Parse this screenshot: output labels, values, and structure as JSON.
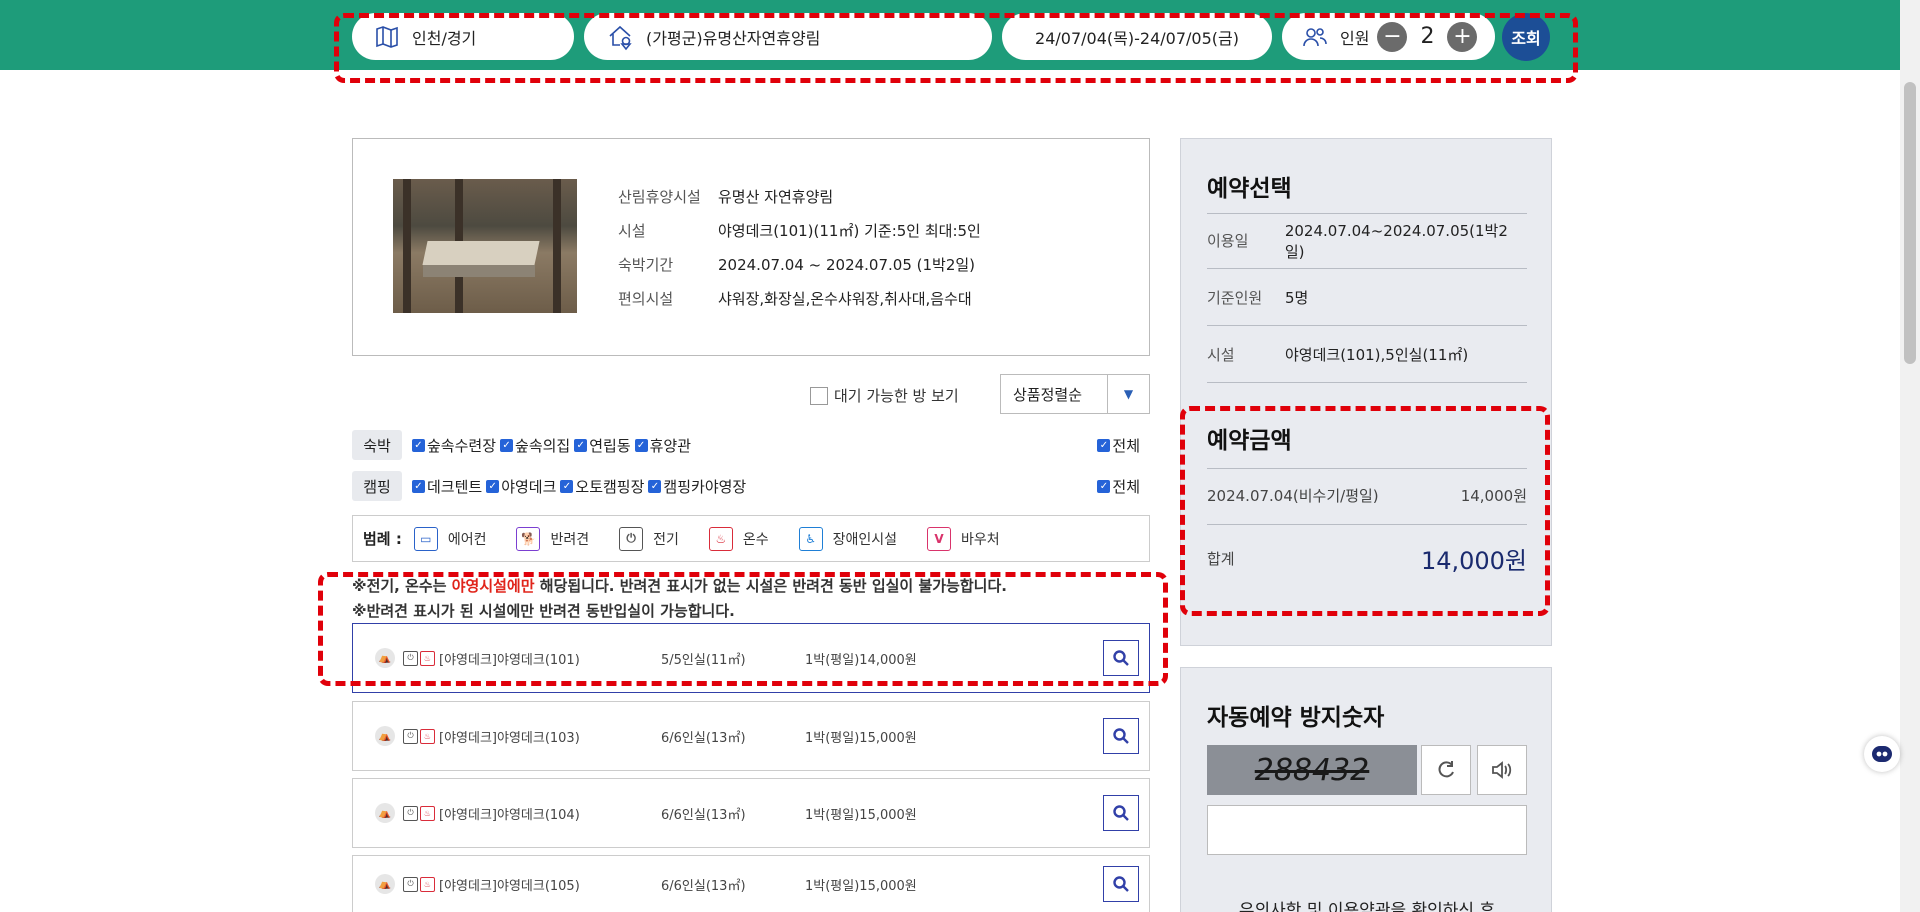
{
  "search": {
    "region": "인천/경기",
    "forest": "(가평군)유명산자연휴양림",
    "dates": "24/07/04(목)-24/07/05(금)",
    "people_label": "인원",
    "minus": "−",
    "people_count": "2",
    "plus": "+",
    "submit": "조회"
  },
  "facility": {
    "rows": [
      {
        "k": "산림휴양시설",
        "v": "유명산 자연휴양림"
      },
      {
        "k": "시설",
        "v": "야영데크(101)(11㎡) 기준:5인 최대:5인"
      },
      {
        "k": "숙박기간",
        "v": "2024.07.04 ~ 2024.07.05 (1박2일)"
      },
      {
        "k": "편의시설",
        "v": "샤워장,화장실,온수샤워장,취사대,음수대"
      }
    ]
  },
  "filters": {
    "waitlist": "대기 가능한 방 보기",
    "sort": "상품정렬순",
    "lodging_tag": "숙박",
    "lodging_items": [
      "숲속수련장",
      "숲속의집",
      "연립동",
      "휴양관"
    ],
    "camping_tag": "캠핑",
    "camping_items": [
      "데크텐트",
      "야영데크",
      "오토캠핑장",
      "캠핑카야영장"
    ],
    "all": "전체"
  },
  "legend": {
    "title": "범례 :",
    "items": [
      {
        "label": "에어컨",
        "color": "#2a62c9",
        "glyph": "▭"
      },
      {
        "label": "반려견",
        "color": "#7b3fd1",
        "glyph": "🐕"
      },
      {
        "label": "전기",
        "color": "#555555",
        "glyph": "⏻"
      },
      {
        "label": "온수",
        "color": "#d92c3a",
        "glyph": "♨"
      },
      {
        "label": "장애인시설",
        "color": "#1f7fd6",
        "glyph": "♿"
      },
      {
        "label": "바우처",
        "color": "#d9336b",
        "glyph": "V"
      }
    ]
  },
  "notices": {
    "line1_a": "※전기, 온수는 ",
    "line1_red": "야영시설에만",
    "line1_b": " 해당됩니다. 반려견 표시가 없는 시설은 반려견 동반 입실이 불가능합니다.",
    "line2": "※반려견 표시가 된 시설에만 반려견 동반입실이 가능합니다."
  },
  "rooms": [
    {
      "name": "[야영데크]야영데크(101)",
      "cap": "5/5인실(11㎡)",
      "price": "1박(평일)14,000원"
    },
    {
      "name": "[야영데크]야영데크(103)",
      "cap": "6/6인실(13㎡)",
      "price": "1박(평일)15,000원"
    },
    {
      "name": "[야영데크]야영데크(104)",
      "cap": "6/6인실(13㎡)",
      "price": "1박(평일)15,000원"
    },
    {
      "name": "[야영데크]야영데크(105)",
      "cap": "6/6인실(13㎡)",
      "price": "1박(평일)15,000원"
    }
  ],
  "summary": {
    "title": "예약선택",
    "rows": [
      {
        "k": "이용일",
        "v": "2024.07.04~2024.07.05(1박2일)"
      },
      {
        "k": "기준인원",
        "v": "5명"
      },
      {
        "k": "시설",
        "v": "야영데크(101),5인실(11㎡)"
      }
    ],
    "price_title": "예약금액",
    "price_line_label": "2024.07.04(비수기/평일)",
    "price_line_value": "14,000원",
    "total_label": "합계",
    "total_value": "14,000원"
  },
  "captcha": {
    "title": "자동예약 방지숫자",
    "code": "288432",
    "note": "유의사항 및 이용약관을 확인하신 후"
  }
}
